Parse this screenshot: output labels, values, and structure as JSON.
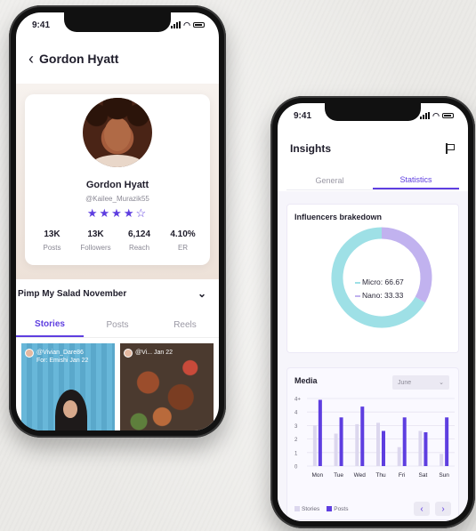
{
  "phone1": {
    "status_time": "9:41",
    "header_title": "Gordon Hyatt",
    "profile": {
      "name": "Gordon Hyatt",
      "handle": "@Kailee_Murazik55",
      "stars_filled": "★★★★",
      "stars_empty": "☆",
      "rating": 4
    },
    "stats": [
      {
        "value": "13K",
        "label": "Posts"
      },
      {
        "value": "13K",
        "label": "Followers"
      },
      {
        "value": "6,124",
        "label": "Reach"
      },
      {
        "value": "4.10%",
        "label": "ER"
      }
    ],
    "campaign_title": "Pimp My Salad November",
    "tabs": [
      "Stories",
      "Posts",
      "Reels"
    ],
    "active_tab": "Stories",
    "tile1_caption_line1": "@Vivian_Dare86",
    "tile1_caption_line2": "For: Emishi Jan 22",
    "tile2_caption": "@Vi... Jan 22"
  },
  "phone2": {
    "status_time": "9:41",
    "header_title": "Insights",
    "tabs": [
      "General",
      "Statistics"
    ],
    "active_tab": "Statistics",
    "donut_card_title": "Influencers brakedown",
    "media_card_title": "Media",
    "month_select_value": "June",
    "legend_stories": "Stories",
    "legend_posts": "Posts",
    "pager_prev": "‹",
    "pager_next": "›",
    "colors": {
      "accent": "#5e3ee0",
      "micro": "#9ee0e6",
      "nano": "#c1b2ef",
      "stories_bar": "#dcd7ee"
    }
  },
  "chart_data": [
    {
      "type": "pie",
      "title": "Influencers brakedown",
      "labels": [
        "Micro",
        "Nano"
      ],
      "values": [
        66.67,
        33.33
      ],
      "display_labels": [
        "Micro: 66.67",
        "Nano: 33.33"
      ]
    },
    {
      "type": "bar",
      "title": "Media",
      "categories": [
        "Mon",
        "Tue",
        "Wed",
        "Thu",
        "Fri",
        "Sat",
        "Sun"
      ],
      "series": [
        {
          "name": "Stories",
          "values": [
            3,
            2.4,
            3.1,
            3.2,
            1.4,
            2.6,
            0.9
          ]
        },
        {
          "name": "Posts",
          "values": [
            4.9,
            3.6,
            4.4,
            2.6,
            3.6,
            2.5,
            3.6
          ]
        }
      ],
      "y_ticks": [
        "0",
        "1",
        "2",
        "3",
        "4",
        "4+"
      ],
      "ylim": [
        0,
        5
      ],
      "grid": true,
      "legend": "bottom-left"
    }
  ]
}
